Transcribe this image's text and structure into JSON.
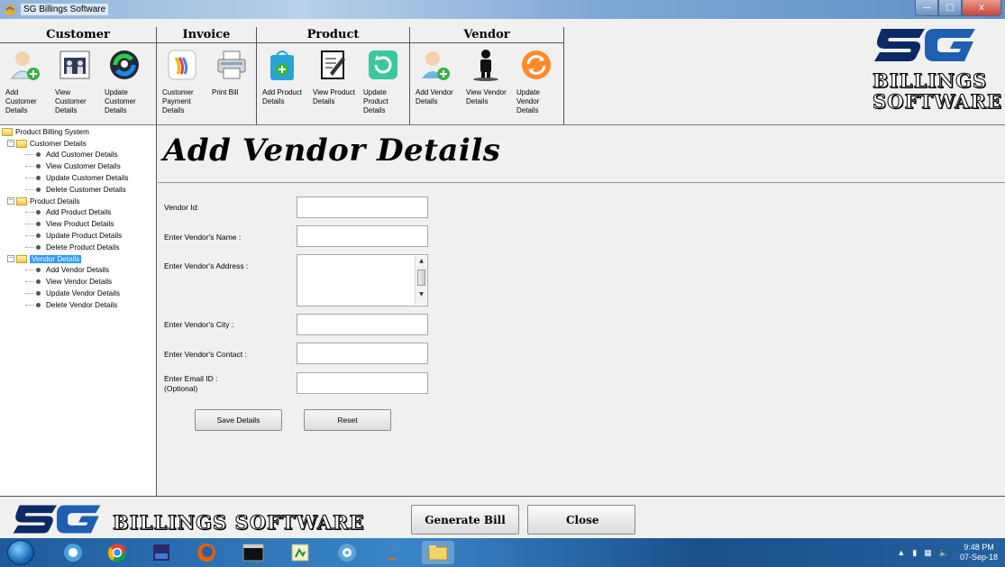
{
  "window": {
    "title": "SG Billings Software",
    "close_glyph": "x"
  },
  "toolbar": {
    "groups": [
      {
        "name": "Customer",
        "items": [
          {
            "label": "Add Customer Details",
            "icon": "add-customer-icon"
          },
          {
            "label": "View Customer Details",
            "icon": "view-customer-icon"
          },
          {
            "label": "Update Customer Details",
            "icon": "update-customer-icon"
          }
        ]
      },
      {
        "name": "Invoice",
        "items": [
          {
            "label": "Customer Payment Details",
            "icon": "payment-icon"
          },
          {
            "label": "Print Bill",
            "icon": "printer-icon"
          }
        ]
      },
      {
        "name": "Product",
        "items": [
          {
            "label": "Add Product Details",
            "icon": "add-product-icon"
          },
          {
            "label": "View Product Details",
            "icon": "view-product-icon"
          },
          {
            "label": "Update Product Details",
            "icon": "update-product-icon"
          }
        ]
      },
      {
        "name": "Vendor",
        "items": [
          {
            "label": "Add Vendor Details",
            "icon": "add-vendor-icon"
          },
          {
            "label": "View Vendor Details",
            "icon": "view-vendor-icon"
          },
          {
            "label": "Update Vendor Details",
            "icon": "update-vendor-icon"
          }
        ]
      }
    ]
  },
  "logo": {
    "mark": "SG",
    "line1": "BILLINGS",
    "line2": "SOFTWARE"
  },
  "tree": {
    "root": "Product Billing System",
    "sections": [
      {
        "label": "Customer Details",
        "children": [
          "Add Customer Details",
          "View Customer Details",
          "Update Customer Details",
          "Delete Customer Details"
        ]
      },
      {
        "label": "Product Details",
        "children": [
          "Add Product Details",
          "View Product Details",
          "Update Product Details",
          "Delete Product Details"
        ]
      },
      {
        "label": "Vendor Details",
        "selected": true,
        "children": [
          "Add Vendor Details",
          "View Vendor Details",
          "Update Vendor Details",
          "Delete Vendor Details"
        ]
      }
    ]
  },
  "form": {
    "heading": "Add Vendor Details",
    "labels": {
      "vendor_id": "Vendor Id:",
      "name": "Enter Vendor's Name :",
      "address": "Enter Vendor's Address :",
      "city": "Enter Vendor's City :",
      "contact": "Enter Vendor's Contact :",
      "email": "Enter Email ID :",
      "email_note": "(Optional)"
    },
    "values": {
      "vendor_id": "",
      "name": "",
      "address": "",
      "city": "",
      "contact": "",
      "email": ""
    },
    "save_label": "Save Details",
    "reset_label": "Reset"
  },
  "footer": {
    "brand": "BILLINGS SOFTWARE",
    "generate_label": "Generate Bill",
    "close_label": "Close"
  },
  "taskbar": {
    "apps": [
      "start-orb",
      "browser-icon",
      "chrome-icon",
      "devcpp-icon",
      "firefox-icon",
      "terminal-icon",
      "paint-icon",
      "media-icon",
      "java-icon",
      "explorer-icon"
    ],
    "time": "9:48 PM",
    "date": "07-Sep-18"
  },
  "colors": {
    "selected": "#3399ff",
    "taskbar": "#1e5a9a"
  }
}
